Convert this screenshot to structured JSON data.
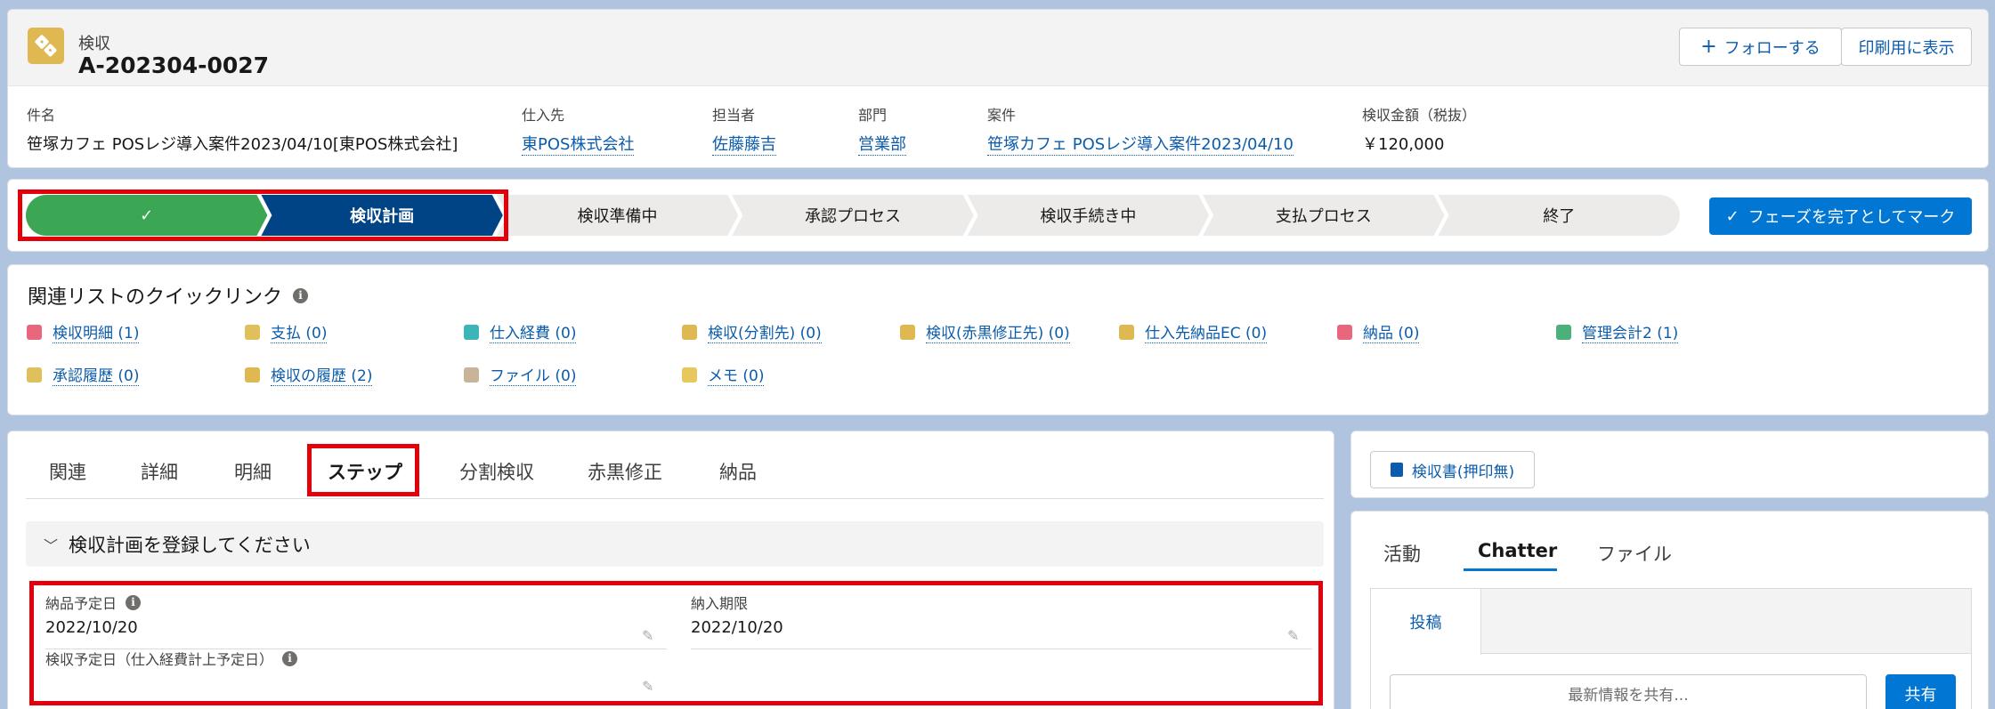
{
  "header": {
    "object_type": "検収",
    "record_name": "A-202304-0027",
    "follow_label": "フォローする",
    "print_label": "印刷用に表示",
    "fields": [
      {
        "label": "件名",
        "value": "笹塚カフェ POSレジ導入案件2023/04/10[東POS株式会社]"
      },
      {
        "label": "仕入先",
        "value": "東POS株式会社"
      },
      {
        "label": "担当者",
        "value": "佐藤藤吉"
      },
      {
        "label": "部門",
        "value": "営業部"
      },
      {
        "label": "案件",
        "value": "笹塚カフェ POSレジ導入案件2023/04/10"
      },
      {
        "label": "検収金額（税抜）",
        "value": "￥120,000"
      }
    ]
  },
  "path": {
    "steps": [
      "✓",
      "検収計画",
      "検収準備中",
      "承認プロセス",
      "検収手続き中",
      "支払プロセス",
      "終了"
    ],
    "current_index": 1,
    "complete_label": "フェーズを完了としてマーク"
  },
  "quick_links": {
    "title": "関連リストのクイックリンク",
    "items": [
      {
        "label": "検収明細 (1)",
        "color": "#e8677c"
      },
      {
        "label": "支払 (0)",
        "color": "#e0c05a"
      },
      {
        "label": "仕入経費 (0)",
        "color": "#3bb5b8"
      },
      {
        "label": "検収(分割先) (0)",
        "color": "#e0b852"
      },
      {
        "label": "検収(赤黒修正先) (0)",
        "color": "#e0b852"
      },
      {
        "label": "仕入先納品EC (0)",
        "color": "#e0b852"
      },
      {
        "label": "納品 (0)",
        "color": "#e8677c"
      },
      {
        "label": "管理会計2 (1)",
        "color": "#4bb07a"
      },
      {
        "label": "承認履歴 (0)",
        "color": "#e0c05a"
      },
      {
        "label": "検収の履歴 (2)",
        "color": "#e0b852"
      },
      {
        "label": "ファイル (0)",
        "color": "#c9b49a"
      },
      {
        "label": "メモ (0)",
        "color": "#e8c85a"
      }
    ]
  },
  "tabs": [
    "関連",
    "詳細",
    "明細",
    "ステップ",
    "分割検収",
    "赤黒修正",
    "納品"
  ],
  "active_tab": "ステップ",
  "section": {
    "title": "検収計画を登録してください",
    "fields": {
      "delivery_date_label": "納品予定日",
      "delivery_date_value": "2022/10/20",
      "deadline_label": "納入期限",
      "deadline_value": "2022/10/20",
      "inspection_date_label": "検収予定日（仕入経費計上予定日）"
    }
  },
  "right": {
    "inspection_doc_label": "検収書(押印無)",
    "feed_tabs": [
      "活動",
      "Chatter",
      "ファイル"
    ],
    "active_feed_tab": "Chatter",
    "post_tab": "投稿",
    "share_placeholder": "最新情報を共有...",
    "share_button": "共有"
  }
}
